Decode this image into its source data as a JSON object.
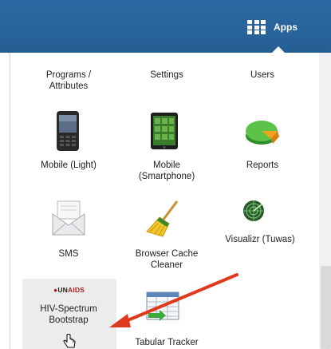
{
  "header": {
    "apps_label": "Apps"
  },
  "menu": {
    "items": [
      {
        "label": "Programs /\nAttributes"
      },
      {
        "label": "Settings"
      },
      {
        "label": "Users"
      },
      {
        "label": "Mobile (Light)"
      },
      {
        "label": "Mobile\n(Smartphone)"
      },
      {
        "label": "Reports"
      },
      {
        "label": "SMS"
      },
      {
        "label": "Browser Cache\nCleaner"
      },
      {
        "label": "Visualizr (Tuwas)"
      },
      {
        "label": "HIV-Spectrum\nBootstrap",
        "logo_text_a": "UN",
        "logo_text_b": "AIDS"
      },
      {
        "label": "Tabular Tracker"
      }
    ]
  },
  "colors": {
    "header_bg": "#2c6aa3",
    "arrow": "#e03a1c",
    "highlight_bg": "#ececec"
  },
  "icons": [
    "apps-grid-icon",
    "mobile-light-icon",
    "smartphone-icon",
    "reports-pie-icon",
    "sms-envelope-icon",
    "broom-icon",
    "radar-icon",
    "unaids-logo",
    "tabular-tracker-icon",
    "hand-cursor-icon"
  ]
}
